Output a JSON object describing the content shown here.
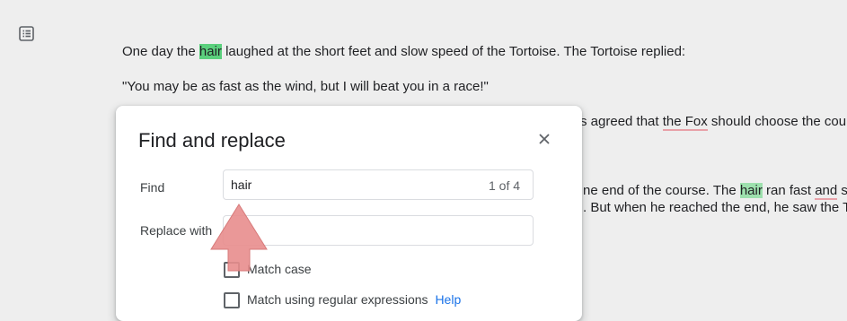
{
  "document": {
    "line1_before": "One day the ",
    "line1_match": "hair",
    "line1_after": " laughed at the short feet and slow speed of the Tortoise. The Tortoise replied:",
    "line2": "\"You may be as fast as the wind, but I will beat you in a race!\"",
    "line3_before": "s agreed that ",
    "line3_fox": "the Fox",
    "line3_after": " should choose the cours",
    "line4_before": "ne end of the course. The ",
    "line4_match": "hair",
    "line4_mid": " ran fast ",
    "line4_and": "and",
    "line4_after": " sto",
    "line5": ". But when he reached the end, he saw the To"
  },
  "dialog": {
    "title": "Find and replace",
    "find_label": "Find",
    "find_value": "hair",
    "match_count": "1 of 4",
    "replace_label": "Replace with",
    "replace_value": "",
    "match_case_label": "Match case",
    "match_case_checked": false,
    "regex_label": "Match using regular expressions",
    "regex_checked": false,
    "help_link": "Help"
  },
  "icons": {
    "outline": "document-outline-icon",
    "close": "close-icon",
    "annotation": "arrow-up-icon"
  },
  "colors": {
    "match_current": "#5bd07d",
    "match_other": "#9de0ad",
    "spell_underline": "#e8a1a8",
    "arrow": "#e88d8d",
    "link": "#1a73e8"
  }
}
